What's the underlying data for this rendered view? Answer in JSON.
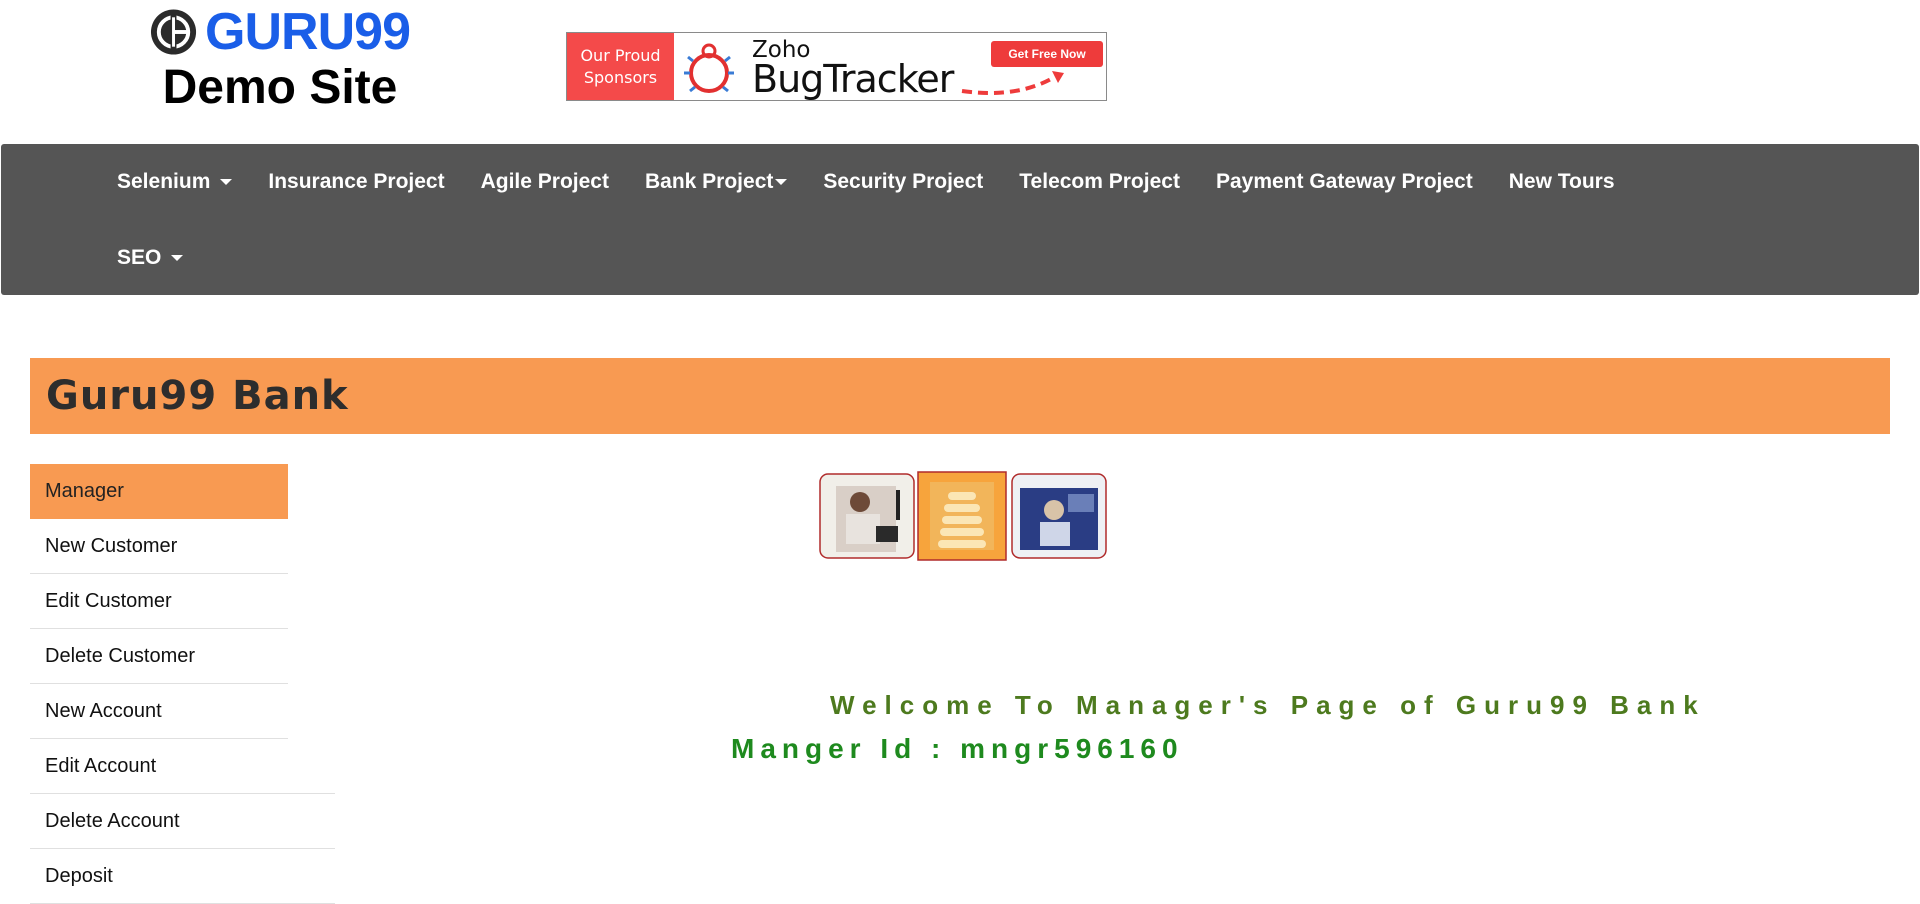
{
  "header": {
    "logo_text": "GURU99",
    "subtitle": "Demo Site"
  },
  "sponsor": {
    "left_line1": "Our Proud",
    "left_line2": "Sponsors",
    "brand_small": "Zoho",
    "brand_large": "BugTracker",
    "cta": "Get Free Now"
  },
  "nav": {
    "row1": [
      {
        "label": "Selenium",
        "dropdown": true
      },
      {
        "label": "Insurance Project",
        "dropdown": false
      },
      {
        "label": "Agile Project",
        "dropdown": false
      },
      {
        "label": "Bank Project",
        "dropdown": true
      },
      {
        "label": "Security Project",
        "dropdown": false
      },
      {
        "label": "Telecom Project",
        "dropdown": false
      },
      {
        "label": "Payment Gateway Project",
        "dropdown": false
      },
      {
        "label": "New Tours",
        "dropdown": false
      }
    ],
    "row2": [
      {
        "label": "SEO",
        "dropdown": true
      }
    ]
  },
  "bank": {
    "title": "Guru99 Bank"
  },
  "sidebar": {
    "items": [
      {
        "label": "Manager",
        "active": true
      },
      {
        "label": "New Customer"
      },
      {
        "label": "Edit Customer"
      },
      {
        "label": "Delete Customer"
      },
      {
        "label": "New Account"
      },
      {
        "label": "Edit Account"
      },
      {
        "label": "Delete Account"
      },
      {
        "label": "Deposit"
      }
    ]
  },
  "main": {
    "welcome": "Welcome To Manager's Page of Guru99 Bank",
    "manager_id": "Manger Id : mngr596160"
  },
  "colors": {
    "accent_orange": "#f89a52",
    "nav_bg": "#555555",
    "welcome_green": "#4d7a1e",
    "id_green": "#1e8a1e",
    "logo_blue": "#1a5ee8"
  }
}
